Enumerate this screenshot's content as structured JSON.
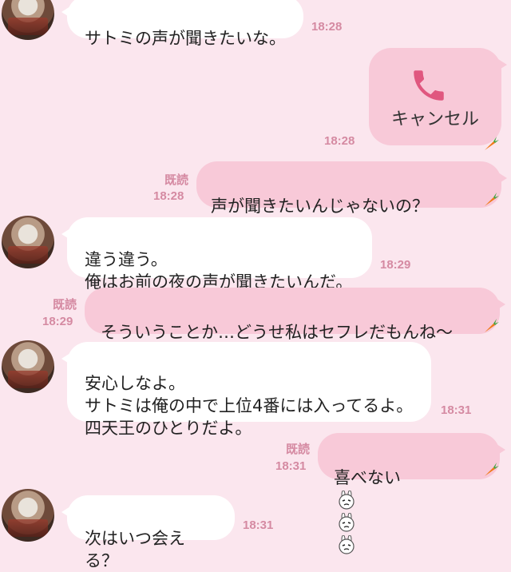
{
  "colors": {
    "background": "#fbe6ee",
    "incoming_bubble": "#ffffff",
    "outgoing_bubble": "#f8c9d8",
    "timestamp": "#d58aa2",
    "phone_icon": "#e0577f"
  },
  "messages": [
    {
      "id": "m1",
      "dir": "in",
      "text": "サトミの声が聞きたいな。",
      "time": "18:28"
    },
    {
      "id": "m2",
      "dir": "out",
      "type": "call",
      "label": "キャンセル",
      "icon": "phone-icon",
      "time": "18:28"
    },
    {
      "id": "m3",
      "dir": "out",
      "text": "声が聞きたいんじゃないの？",
      "emojis": [
        "bunny-shocked-icon",
        "sweat-icon"
      ],
      "read": "既読",
      "time": "18:28"
    },
    {
      "id": "m4",
      "dir": "in",
      "text": "違う違う。\n俺はお前の夜の声が聞きたいんだ。",
      "time": "18:29"
    },
    {
      "id": "m5",
      "dir": "out",
      "text": "そういうことか…どうせ私はセフレだもんね～",
      "emojis": [
        "bunny-crying-icon"
      ],
      "read": "既読",
      "time": "18:29"
    },
    {
      "id": "m6",
      "dir": "in",
      "text": "安心しなよ。\nサトミは俺の中で上位4番には入ってるよ。\n四天王のひとりだよ。",
      "time": "18:31"
    },
    {
      "id": "m7",
      "dir": "out",
      "text": "喜べない",
      "emojis": [
        "bunny-crying-icon",
        "bunny-crying-icon",
        "bunny-crying-icon"
      ],
      "read": "既読",
      "time": "18:31"
    },
    {
      "id": "m8",
      "dir": "in",
      "text": "次はいつ会える？",
      "time": "18:31"
    }
  ]
}
